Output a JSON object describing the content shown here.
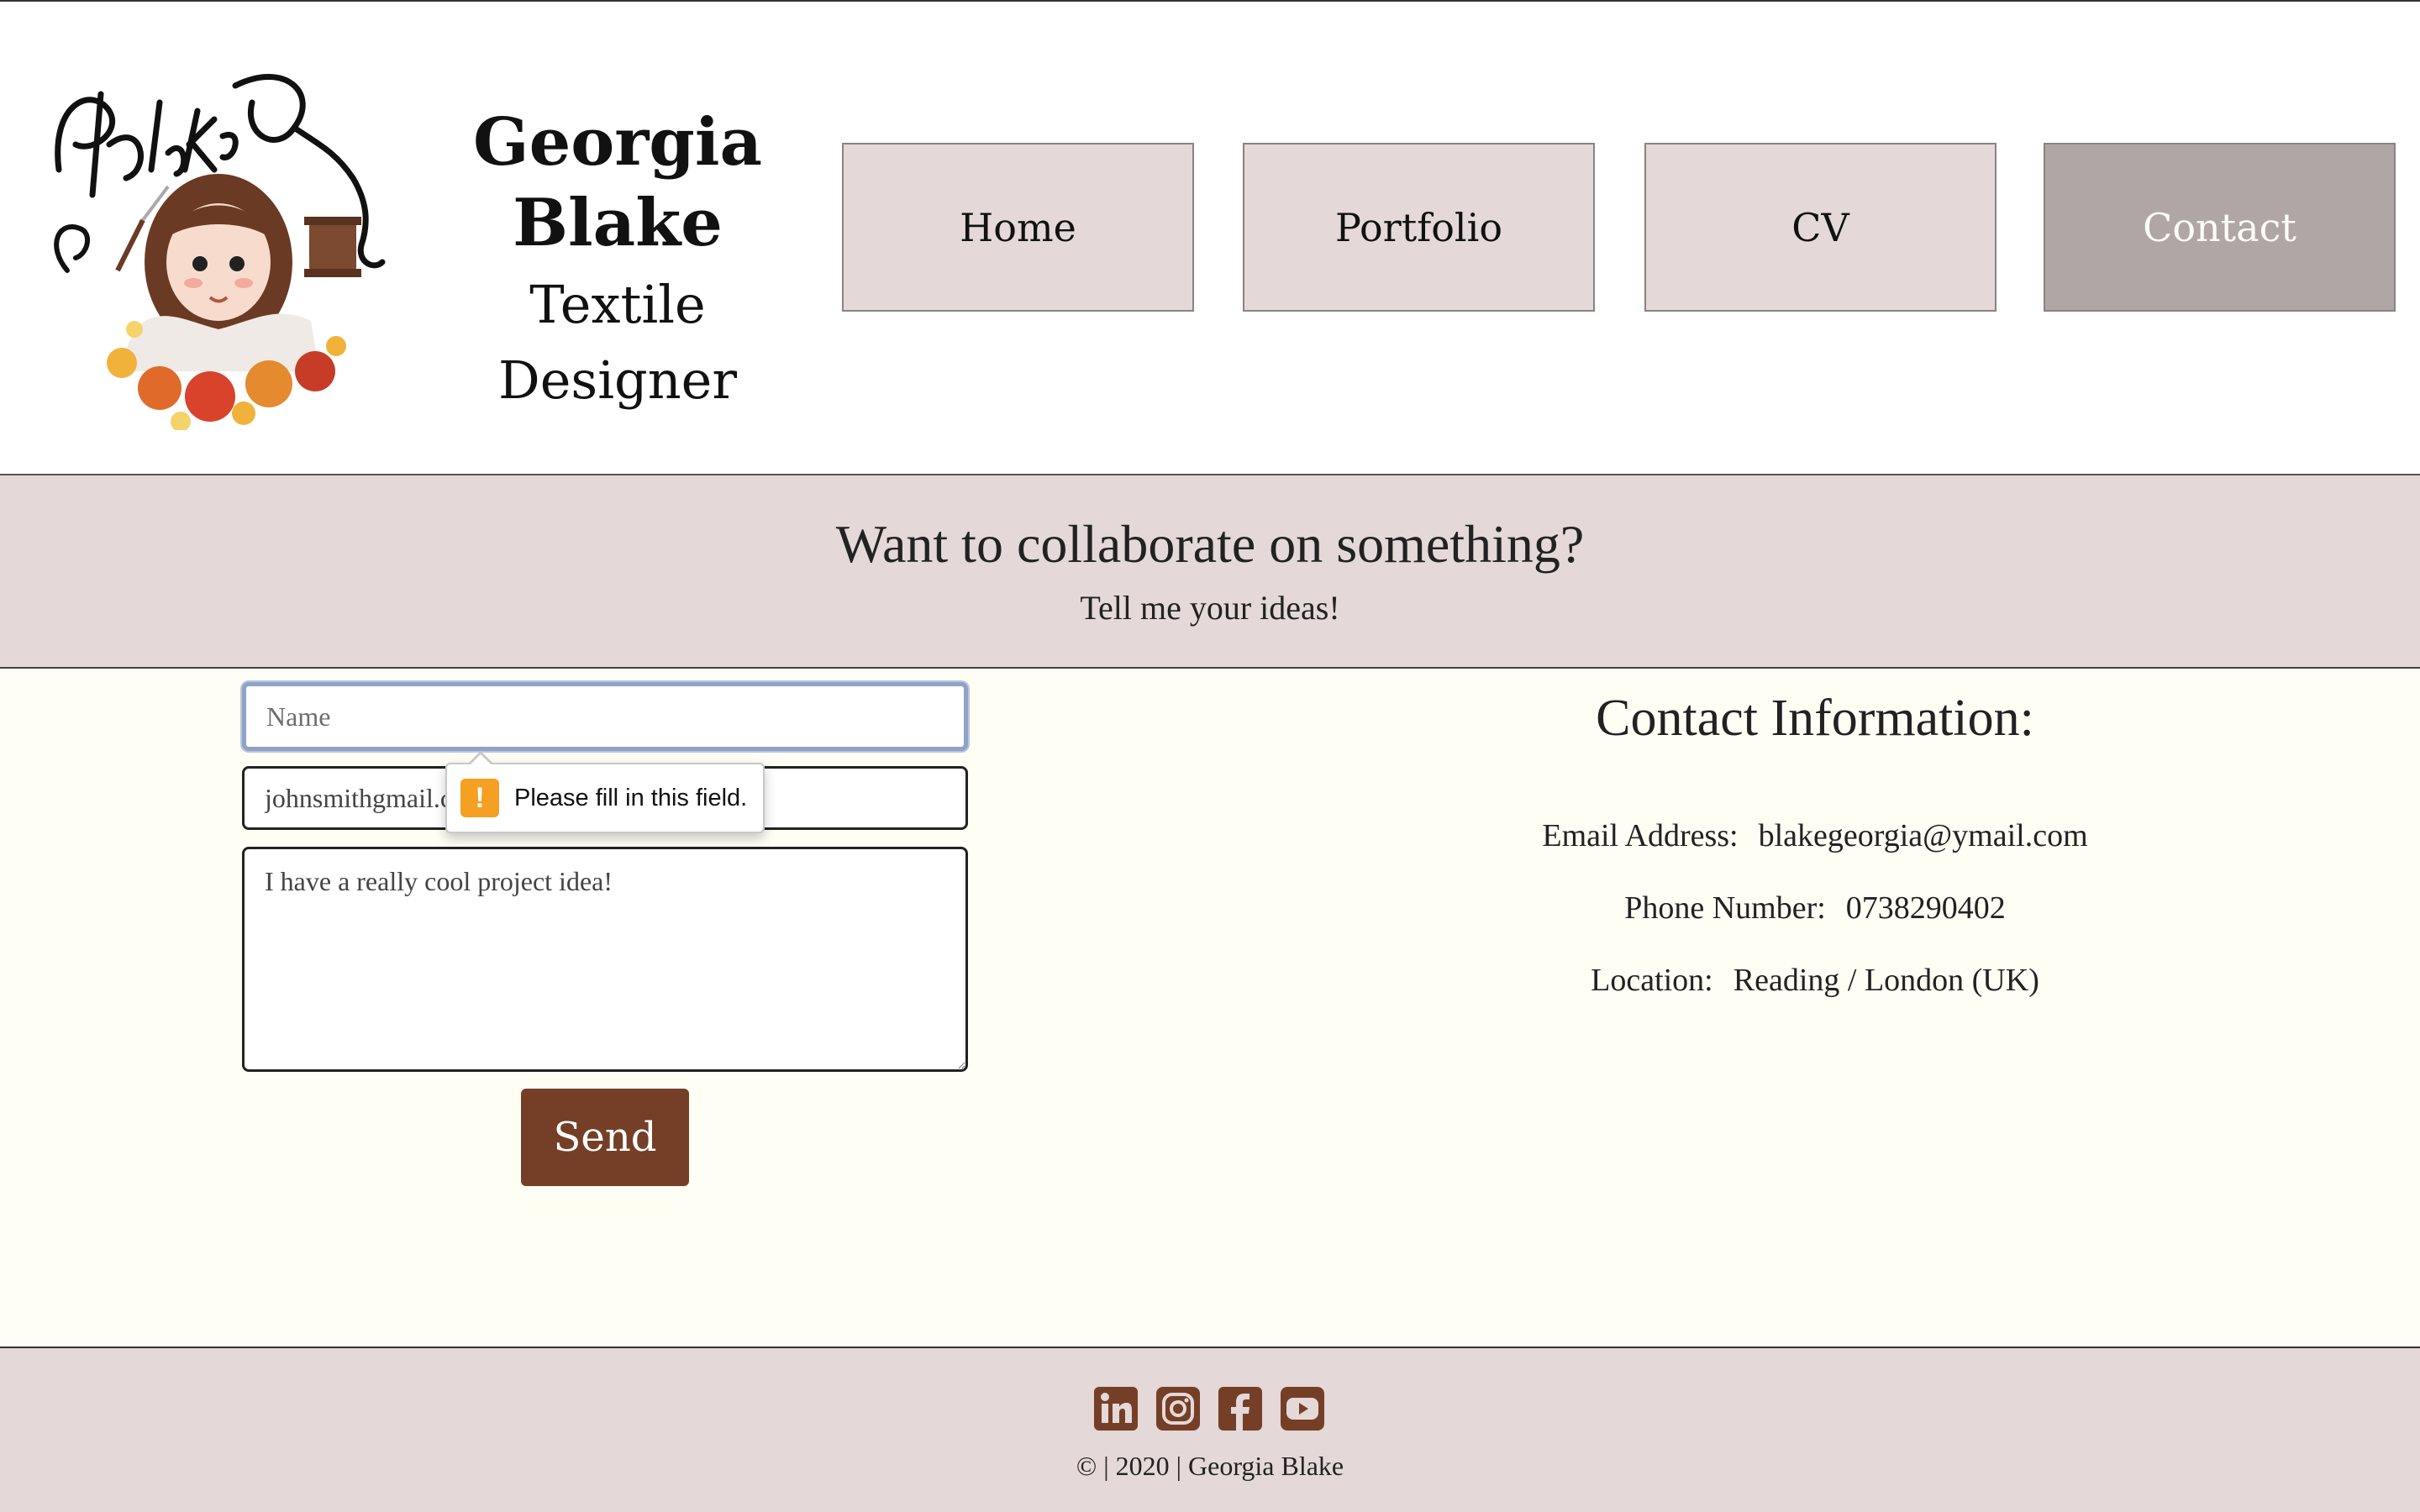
{
  "header": {
    "logo_text": "Blake Designs",
    "brand_name_line1": "Georgia",
    "brand_name_line2": "Blake",
    "brand_role": "Textile Designer"
  },
  "nav": {
    "items": [
      {
        "label": "Home",
        "active": false
      },
      {
        "label": "Portfolio",
        "active": false
      },
      {
        "label": "CV",
        "active": false
      },
      {
        "label": "Contact",
        "active": true
      }
    ]
  },
  "banner": {
    "title": "Want to collaborate on something?",
    "subtitle": "Tell me your ideas!"
  },
  "form": {
    "name_placeholder": "Name",
    "name_value": "",
    "email_value": "johnsmithgmail.com",
    "message_value": "I have a really cool project idea!",
    "send_label": "Send",
    "validation_message": "Please fill in this field."
  },
  "contact": {
    "title": "Contact Information:",
    "email_label": "Email Address:",
    "email_value": "blakegeorgia@ymail.com",
    "phone_label": "Phone Number:",
    "phone_value": "0738290402",
    "location_label": "Location:",
    "location_value": "Reading / London (UK)"
  },
  "footer": {
    "social_icons": [
      "linkedin-icon",
      "instagram-icon",
      "facebook-icon",
      "youtube-icon"
    ],
    "copyright": "© | 2020 | Georgia Blake"
  },
  "colors": {
    "accent_brown": "#753f27",
    "pale_pink": "#e4d8d8",
    "active_nav": "#b0a6a5",
    "cream_background": "#fffef5",
    "warning_orange": "#f5a023"
  }
}
